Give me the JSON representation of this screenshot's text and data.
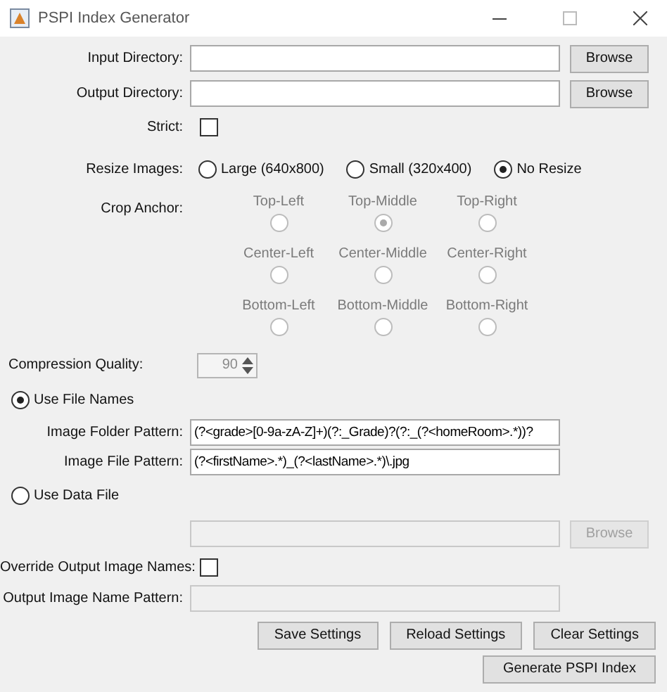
{
  "window": {
    "title": "PSPI Index Generator"
  },
  "input_directory": {
    "label": "Input Directory:",
    "button": "Browse"
  },
  "output_directory": {
    "label": "Output Directory:",
    "button": "Browse"
  },
  "strict": {
    "label": "Strict:",
    "checked": false
  },
  "resize_images": {
    "label": "Resize Images:",
    "options": [
      {
        "label": "Large (640x800)",
        "selected": false
      },
      {
        "label": "Small (320x400)",
        "selected": false
      },
      {
        "label": "No Resize",
        "selected": true
      }
    ]
  },
  "crop_anchor": {
    "label": "Crop Anchor:",
    "disabled": true,
    "options": [
      {
        "label": "Top-Left",
        "selected": false
      },
      {
        "label": "Top-Middle",
        "selected": true
      },
      {
        "label": "Top-Right",
        "selected": false
      },
      {
        "label": "Center-Left",
        "selected": false
      },
      {
        "label": "Center-Middle",
        "selected": false
      },
      {
        "label": "Center-Right",
        "selected": false
      },
      {
        "label": "Bottom-Left",
        "selected": false
      },
      {
        "label": "Bottom-Middle",
        "selected": false
      },
      {
        "label": "Bottom-Right",
        "selected": false
      }
    ]
  },
  "compression_quality": {
    "label": "Compression Quality:",
    "value": "90",
    "disabled": true
  },
  "use_file_names": {
    "label": "Use File Names",
    "selected": true
  },
  "image_folder_pattern": {
    "label": "Image Folder Pattern:",
    "value": "(?<grade>[0-9a-zA-Z]+)(?:_Grade)?(?:_(?<homeRoom>.*))?"
  },
  "image_file_pattern": {
    "label": "Image File Pattern:",
    "value": "(?<firstName>.*)_(?<lastName>.*)\\.jpg"
  },
  "use_data_file": {
    "label": "Use Data File",
    "selected": false
  },
  "data_file": {
    "button": "Browse",
    "disabled": true
  },
  "override_output_names": {
    "label": "Override Output Image Names:",
    "checked": false
  },
  "output_name_pattern": {
    "label": "Output Image Name Pattern:",
    "disabled": true
  },
  "buttons": [
    "Save Settings",
    "Reload Settings",
    "Clear Settings"
  ],
  "generate_button": "Generate PSPI Index"
}
